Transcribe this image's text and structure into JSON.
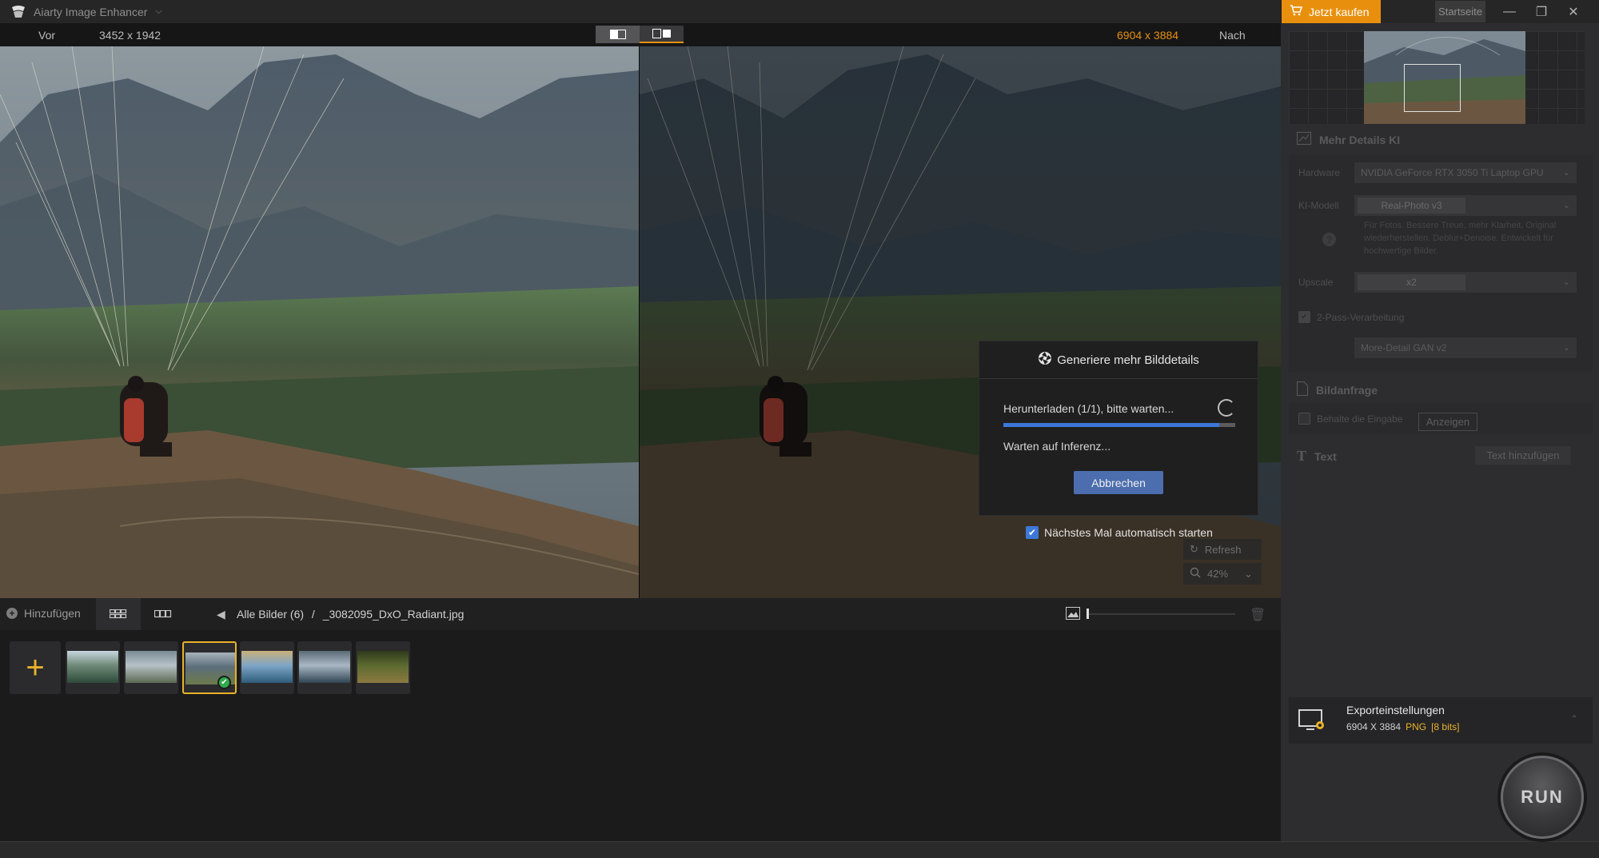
{
  "app": {
    "title": "Aiarty Image Enhancer"
  },
  "header": {
    "buy_label": "Jetzt kaufen",
    "home_label": "Startseite"
  },
  "compare": {
    "before_label": "Vor",
    "before_size": "3452 x 1942",
    "after_size": "6904 x 3884",
    "after_label": "Nach"
  },
  "dialog": {
    "title": "Generiere mehr Bilddetails",
    "status_download": "Herunterladen (1/1), bitte warten...",
    "download_progress": 0.93,
    "status_wait": "Warten auf Inferenz...",
    "cancel_label": "Abbrechen",
    "autostart_label": "Nächstes Mal automatisch starten",
    "autostart_checked": true
  },
  "overlay": {
    "refresh_label": "Refresh",
    "zoom_value": "42%"
  },
  "gallery": {
    "add_label": "Hinzufügen",
    "path_all": "Alle Bilder (6)",
    "path_sep": "/",
    "file_name": "_3082095_DxO_Radiant.jpg",
    "thumbnails": [
      {
        "colors": [
          "#6f8a78",
          "#2d4a3a",
          "#c9d6e0"
        ]
      },
      {
        "colors": [
          "#b7c1c8",
          "#5c6a52",
          "#7b8c95"
        ]
      },
      {
        "colors": [
          "#5c6e7b",
          "#6c7a4a",
          "#a8b3bb"
        ],
        "selected": true
      },
      {
        "colors": [
          "#7fa6c7",
          "#2e5c7a",
          "#c9b07a"
        ]
      },
      {
        "colors": [
          "#a9b7c4",
          "#304452",
          "#5b6b76"
        ]
      },
      {
        "colors": [
          "#5c6a30",
          "#8c7a40",
          "#2e3a1c"
        ]
      }
    ]
  },
  "panel": {
    "section_ai": "Mehr Details KI",
    "hardware_label": "Hardware",
    "hardware_value": "NVIDIA GeForce RTX 3050 Ti Laptop GPU",
    "model_label": "KI-Modell",
    "model_value": "Real-Photo v3",
    "model_hint": "Für Fotos. Bessere Treue, mehr Klarheit. Original wiederherstellen. Deblur+Denoise. Entwickelt für hochwertige Bilder.",
    "upscale_label": "Upscale",
    "upscale_value": "x2",
    "twopass_label": "2-Pass-Verarbeitung",
    "twopass_value": "More-Detail GAN v2",
    "section_prompt": "Bildanfrage",
    "keep_input_label": "Behalte die Eingabe",
    "show_label": "Anzeigen",
    "section_text": "Text",
    "add_text_label": "Text hinzufügen",
    "export_title": "Exporteinstellungen",
    "export_size": "6904 X 3884",
    "export_format": "PNG",
    "export_bits": "[8 bits]",
    "run_label": "RUN"
  },
  "colors": {
    "accent_orange": "#e8900e",
    "accent_yellow": "#e8b22a",
    "progress_blue": "#3c78d8",
    "cancel_button": "#4c6eae"
  }
}
